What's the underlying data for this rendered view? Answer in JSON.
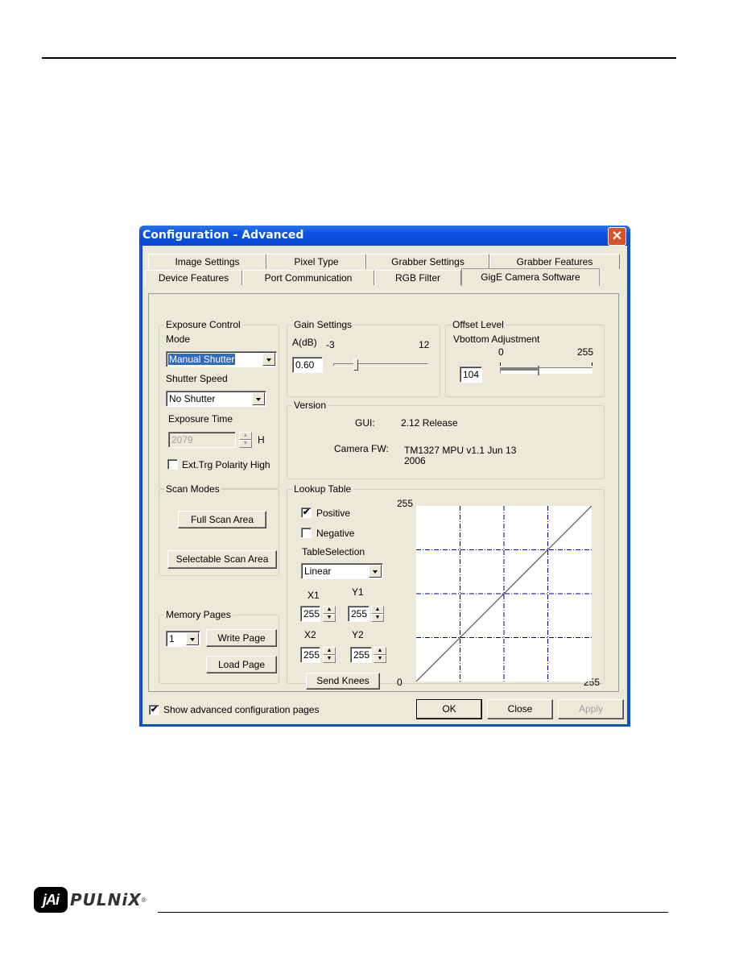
{
  "window": {
    "title": "Configuration - Advanced",
    "close_glyph": "✕"
  },
  "tabs": {
    "row1": [
      {
        "label": "Image Settings"
      },
      {
        "label": "Pixel Type"
      },
      {
        "label": "Grabber Settings"
      },
      {
        "label": "Grabber Features"
      }
    ],
    "row2": [
      {
        "label": "Device Features"
      },
      {
        "label": "Port Communication"
      },
      {
        "label": "RGB Filter"
      },
      {
        "label": "GigE Camera Software",
        "active": true
      }
    ]
  },
  "exposure": {
    "title": "Exposure Control",
    "mode_label": "Mode",
    "mode_value": "Manual Shutter",
    "shutter_label": "Shutter Speed",
    "shutter_value": "No Shutter",
    "exposure_time_label": "Exposure Time",
    "exposure_time_value": "2079",
    "exposure_unit": "H",
    "ext_trg_label": "Ext.Trg Polarity High",
    "ext_trg_checked": false
  },
  "gain": {
    "title": "Gain Settings",
    "label": "A(dB)",
    "min_label": "-3",
    "max_label": "12",
    "value": "0.60",
    "min": -3,
    "max": 12,
    "current": 0.6
  },
  "offset": {
    "title": "Offset Level",
    "label": "Vbottom Adjustment",
    "min_label": "0",
    "max_label": "255",
    "value": "104",
    "min": 0,
    "max": 255,
    "current": 104
  },
  "version": {
    "title": "Version",
    "gui_label": "GUI:",
    "gui_value": "2.12 Release",
    "fw_label": "Camera FW:",
    "fw_value_line1": "TM1327 MPU v1.1   Jun 13",
    "fw_value_line2": "2006"
  },
  "scan_modes": {
    "title": "Scan Modes",
    "full_button": "Full Scan Area",
    "selectable_button": "Selectable Scan Area"
  },
  "memory_pages": {
    "title": "Memory Pages",
    "page_value": "1",
    "write_button": "Write Page",
    "load_button": "Load Page"
  },
  "lookup_table": {
    "title": "Lookup Table",
    "positive_label": "Positive",
    "positive_checked": true,
    "negative_label": "Negative",
    "negative_checked": false,
    "table_selection_label": "TableSelection",
    "table_selection_value": "Linear",
    "x1_label": "X1",
    "x1_value": "255",
    "y1_label": "Y1",
    "y1_value": "255",
    "x2_label": "X2",
    "x2_value": "255",
    "y2_label": "Y2",
    "y2_value": "255",
    "send_knees_button": "Send Knees",
    "axis_top_label": "255",
    "axis_origin_label": "0",
    "axis_right_label": "255",
    "plot": {
      "range": [
        0,
        255
      ],
      "grid_divisions": 4,
      "curve": [
        [
          0,
          0
        ],
        [
          255,
          255
        ]
      ],
      "grid_color": "#00007f",
      "curve_color": "#404040"
    }
  },
  "footer": {
    "show_advanced_label": "Show advanced configuration pages",
    "show_advanced_checked": true,
    "ok_button": "OK",
    "close_button": "Close",
    "apply_button": "Apply"
  },
  "page": {
    "logo_badge": "jAi",
    "logo_text": "PULNiX",
    "logo_reg": "®"
  },
  "glyphs": {
    "check": "✔",
    "spin_up": "▲",
    "spin_down": "▼"
  }
}
